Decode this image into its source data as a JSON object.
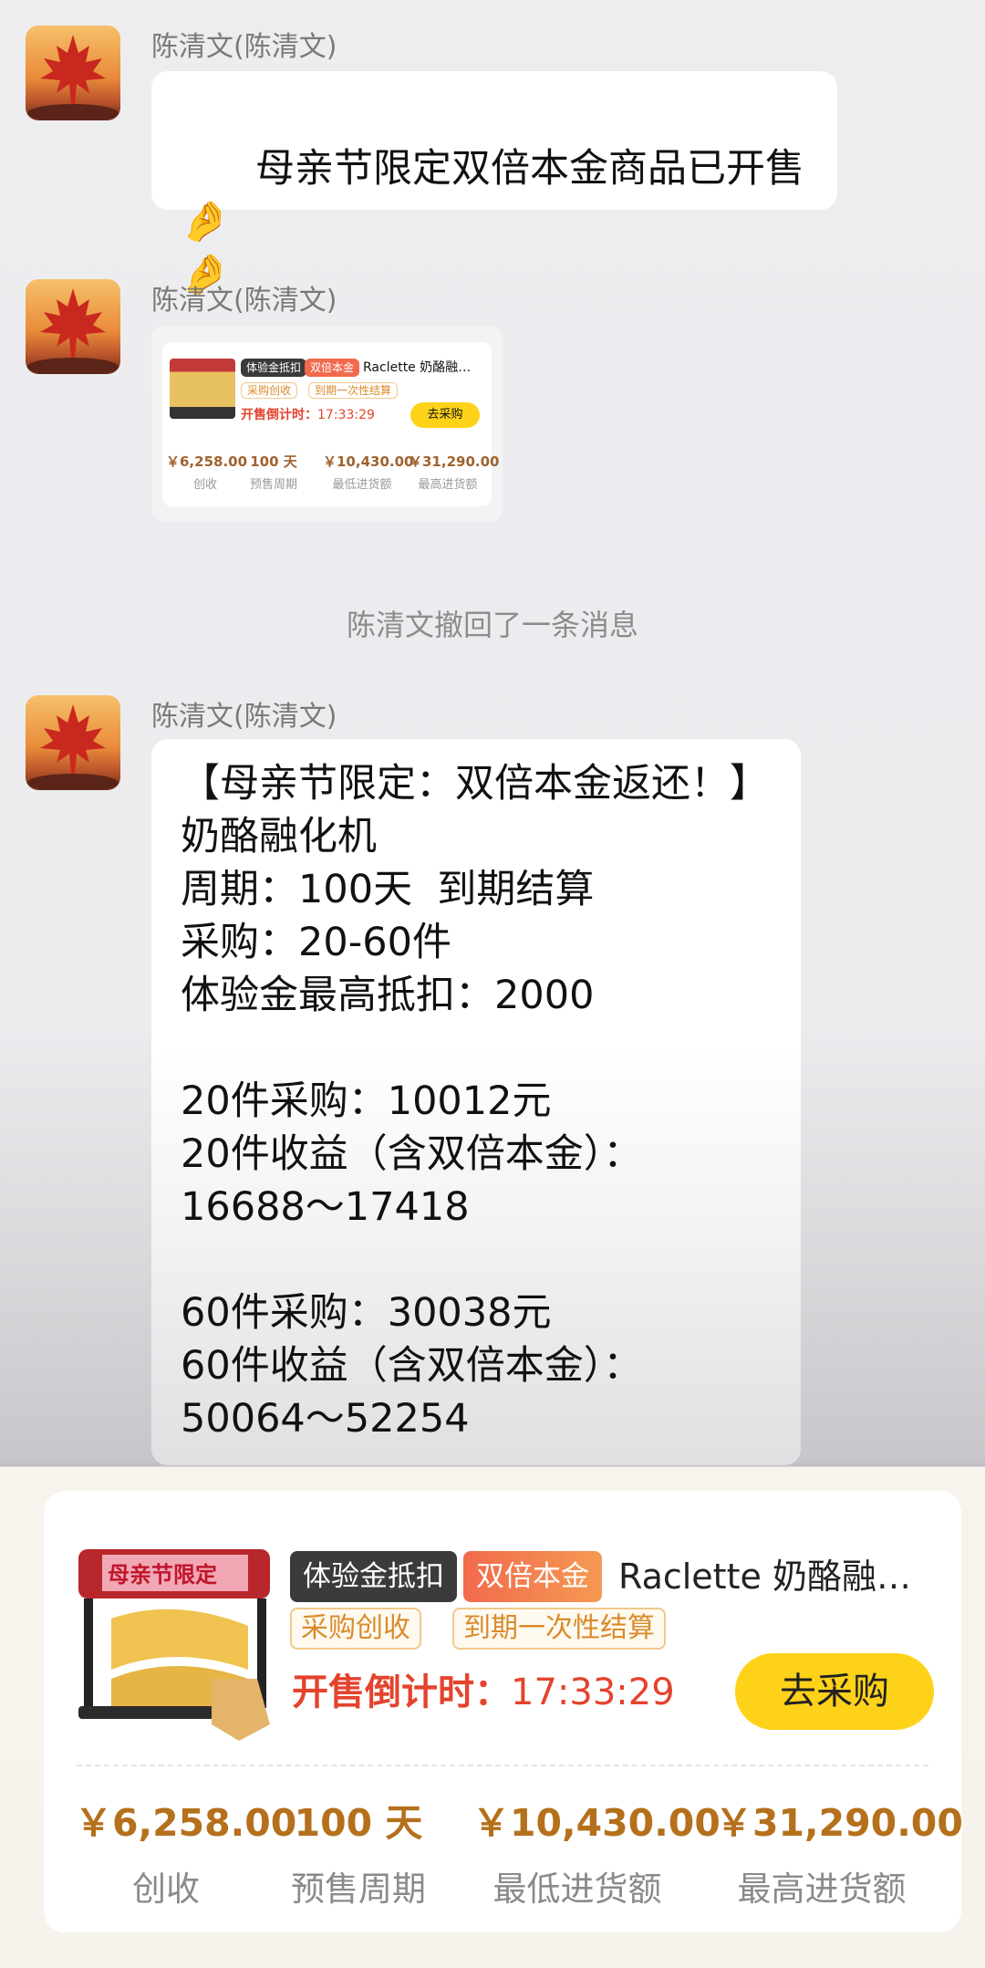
{
  "messages": [
    {
      "sender": "陈清文(陈清文)",
      "text": "母亲节限定双倍本金商品已开售"
    },
    {
      "sender": "陈清文(陈清文)"
    },
    {
      "sender": "陈清文(陈清文)",
      "text": "【母亲节限定：双倍本金返还！】\n奶酪融化机\n周期：100天  到期结算\n采购：20-60件\n体验金最高抵扣：2000\n\n20件采购：10012元\n20件收益（含双倍本金）：\n16688～17418\n\n60件采购：30038元\n60件收益（含双倍本金）：\n50064～52254"
    }
  ],
  "system_notice": "陈清文撤回了一条消息",
  "emoji": "🤌",
  "product": {
    "image_banner": "母亲节限定",
    "tag_exp": "体验金抵扣",
    "tag_double": "双倍本金",
    "title": "Raclette 奶酪融…",
    "tag_purchase": "采购创收",
    "tag_settle": "到期一次性结算",
    "countdown_label": "开售倒计时：",
    "countdown_time": "17:33:29",
    "buy_label": "去采购",
    "stats": [
      {
        "value": "￥6,258.00",
        "label": "创收"
      },
      {
        "value": "100 天",
        "label": "预售周期"
      },
      {
        "value": "￥10,430.00",
        "label": "最低进货额"
      },
      {
        "value": "￥31,290.00",
        "label": "最高进货额"
      }
    ]
  },
  "colors": {
    "accent": "#ffd21a",
    "countdown": "#e4432d",
    "price": "#b5701c"
  }
}
